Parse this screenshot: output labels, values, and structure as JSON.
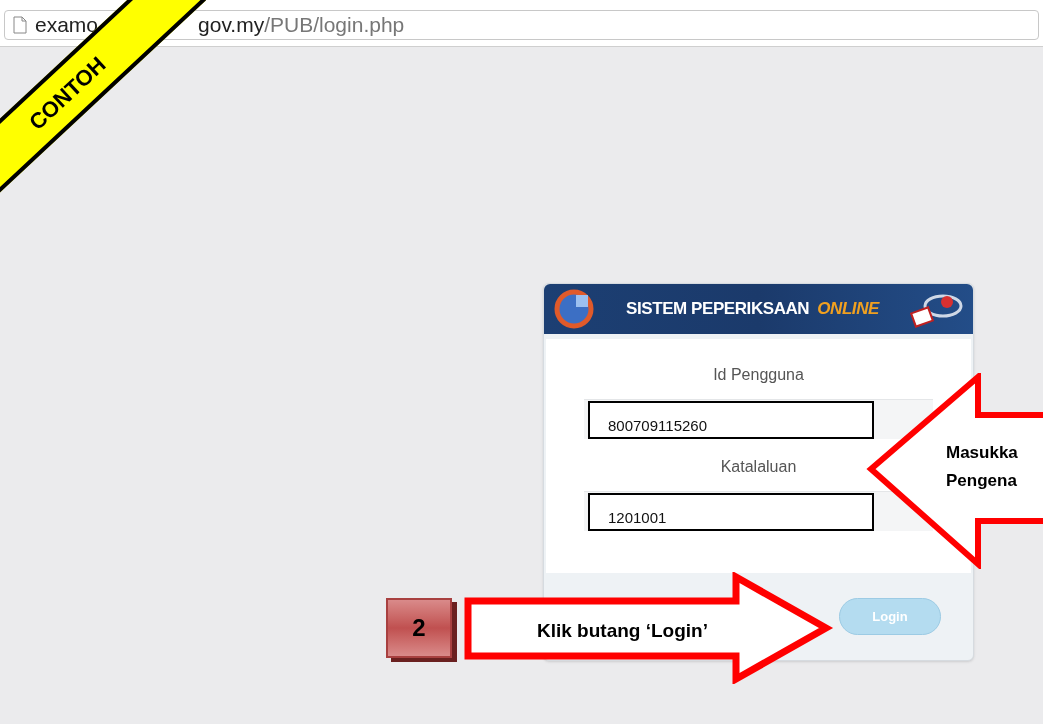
{
  "address_bar": {
    "host_start": "examo",
    "host_end": "gov.my",
    "path": "/PUB/login.php"
  },
  "sample_banner": {
    "text": "CONTOH"
  },
  "login_card": {
    "title": "SISTEM PEPERIKSAAN",
    "title_accent": "ONLINE",
    "fields": [
      {
        "label": "Id Pengguna",
        "value": "800709115260"
      },
      {
        "label": "Katalaluan",
        "value": "1201001"
      }
    ],
    "button": {
      "label": "Login",
      "disabled": true
    }
  },
  "annotations": [
    {
      "kind": "left-arrow",
      "lines": [
        "Masukka",
        "Pengena"
      ]
    },
    {
      "kind": "step",
      "text": "2"
    },
    {
      "kind": "right-arrow",
      "lines": [
        "Klik butang ‘Login’"
      ]
    }
  ]
}
